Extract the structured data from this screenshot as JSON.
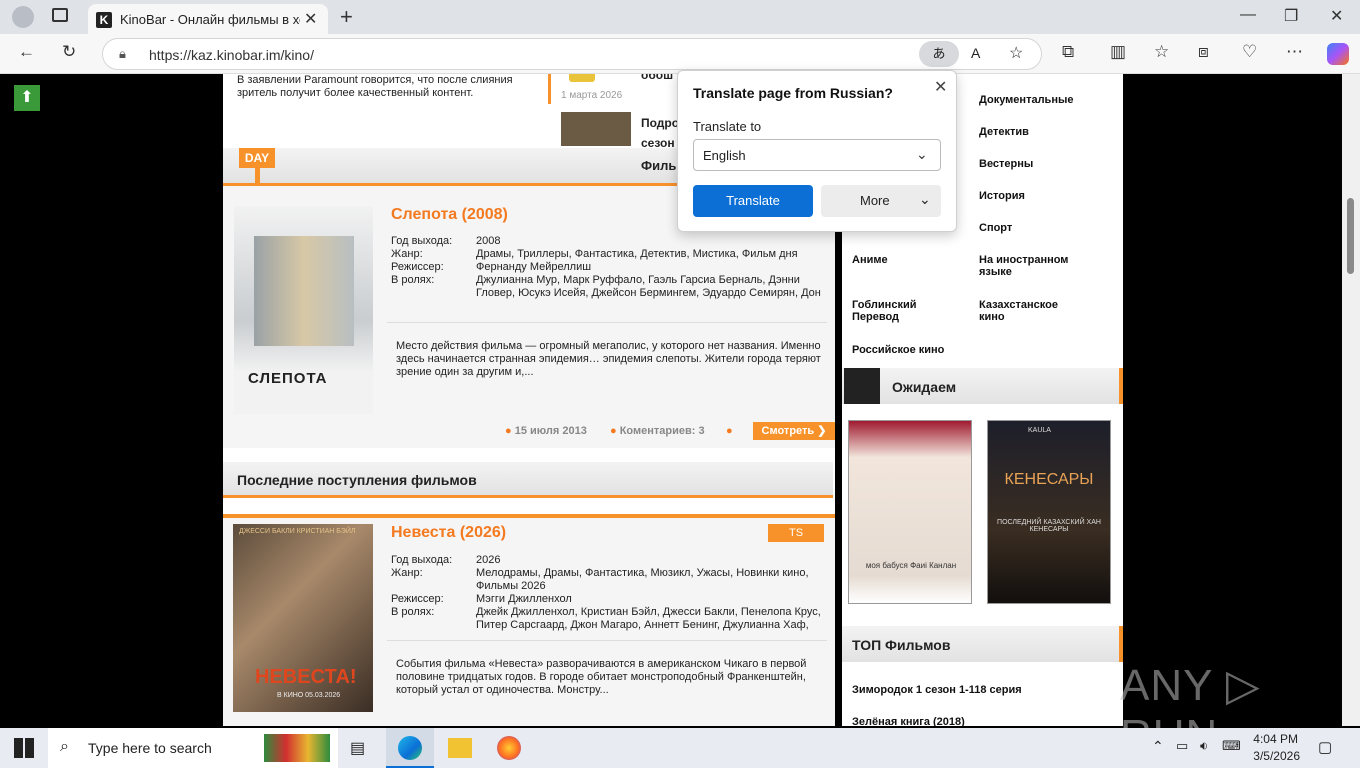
{
  "browser": {
    "tab_title": "KinoBar - Онлайн фильмы в хоро",
    "tab_favicon": "K",
    "url": "https://kaz.kinobar.im/kino/"
  },
  "translate_popup": {
    "title": "Translate page from Russian?",
    "translate_to_label": "Translate to",
    "language": "English",
    "translate_button": "Translate",
    "more_button": "More"
  },
  "top_snippet": {
    "text": "В заявлении Paramount говорится, что после слияния зритель получит более качественный контент.",
    "date": "1 марта 2026",
    "news1": "обош",
    "news2a": "Подро",
    "news2b": "сезон"
  },
  "day_badge": "DAY",
  "day_header": "Филь",
  "featured": {
    "title": "Слепота (2008)",
    "poster_text": "СЛЕПОТА",
    "year_label": "Год выхода:",
    "year": "2008",
    "genre_label": "Жанр:",
    "genre": "Драмы, Триллеры, Фантастика, Детектив, Мистика, Фильм дня",
    "director_label": "Режиссер:",
    "director": "Фернанду Мейреллиш",
    "cast_label": "В ролях:",
    "cast": "Джулианна Мур, Марк Руффало, Гаэль Гарсиа Берналь, Дэнни Гловер, Юсукэ Исейя, Джейсон Бермингем, Эдуардо Семирян, Дон",
    "description": "Место действия фильма — огромный мегаполис, у которого нет названия. Именно здесь начинается странная эпидемия… эпидемия слепоты. Жители города теряют зрение один за другим и,...",
    "date": "15 июля 2013",
    "comments": "Коментариев: 3",
    "watch": "Смотреть ❯"
  },
  "latest_header": "Последние поступления фильмов",
  "movie2": {
    "title": "Невеста (2026)",
    "badge": "TS",
    "poster_top": "ДЖЕССИ БАКЛИ   КРИСТИАН БЭЙЛ",
    "poster_text": "НЕВЕСТА!",
    "poster_date": "В КИНО 05.03.2026",
    "year_label": "Год выхода:",
    "year": "2026",
    "genre_label": "Жанр:",
    "genre": "Мелодрамы, Драмы, Фантастика, Мюзикл, Ужасы, Новинки кино, Фильмы 2026",
    "director_label": "Режиссер:",
    "director": "Мэгги Джилленхол",
    "cast_label": "В ролях:",
    "cast": "Джейк Джилленхол, Кристиан Бэйл, Джесси Бакли, Пенелопа Крус, Питер Сарсгаард, Джон Магаро, Аннетт Бенинг, Джулианна Хаф,",
    "description": "События фильма «Невеста» разворачиваются в американском Чикаго в первой половине тридцатых годов. В городе обитает монстроподобный Франкенштейн, который устал от одиночества. Монстру..."
  },
  "sidebar": {
    "genres_left": [
      "Аниме",
      "Гоблинский Перевод",
      "Российское кино"
    ],
    "genres_right": [
      "Документальные",
      "Детектив",
      "Вестерны",
      "История",
      "Спорт",
      "На иностранном языке",
      "Казахстанское кино"
    ],
    "expected_header": "Ожидаем",
    "poster1_text": "моя бабуся Фаиі Канлан",
    "poster2_top": "KAULA",
    "poster2_title": "КЕНЕСАРЫ",
    "poster2_sub": "ПОСЛЕДНИЙ КАЗАХСКИЙ ХАН КЕНЕСАРЫ",
    "top_header": "ТОП Фильмов",
    "top1": "Зимородок 1 сезон 1-118 серия",
    "top2": "Зелёная книга (2018)"
  },
  "watermark": "ANY ▷ RUN",
  "taskbar": {
    "search_placeholder": "Type here to search",
    "time": "4:04 PM",
    "date": "3/5/2026"
  },
  "colors": {
    "accent": "#f47a20",
    "edge_blue": "#0b6fd6"
  }
}
